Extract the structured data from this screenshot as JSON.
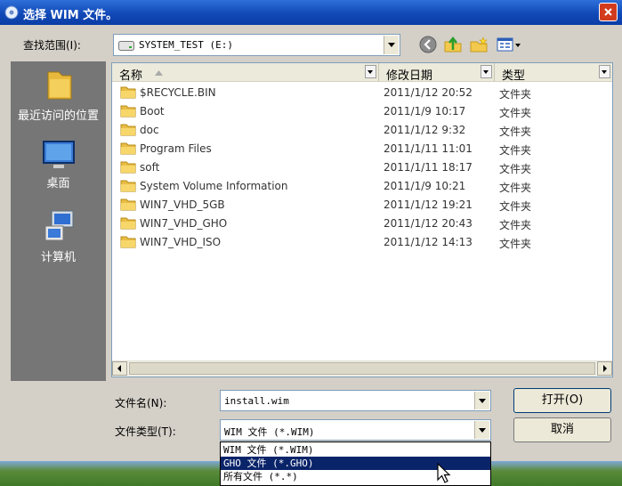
{
  "window": {
    "title": "选择 WIM 文件。"
  },
  "lookin": {
    "label": "查找范围(I):",
    "value": "SYSTEM_TEST  (E:)"
  },
  "places": [
    {
      "label": "最近访问的位置",
      "icon": "recent-folder-icon"
    },
    {
      "label": "桌面",
      "icon": "desktop-icon"
    },
    {
      "label": "计算机",
      "icon": "computer-icon"
    }
  ],
  "columns": {
    "name": "名称",
    "modified": "修改日期",
    "type": "类型"
  },
  "files": [
    {
      "name": "$RECYCLE.BIN",
      "date": "2011/1/12 20:52",
      "type": "文件夹"
    },
    {
      "name": "Boot",
      "date": "2011/1/9 10:17",
      "type": "文件夹"
    },
    {
      "name": "doc",
      "date": "2011/1/12 9:32",
      "type": "文件夹"
    },
    {
      "name": "Program Files",
      "date": "2011/1/11 11:01",
      "type": "文件夹"
    },
    {
      "name": "soft",
      "date": "2011/1/11 18:17",
      "type": "文件夹"
    },
    {
      "name": "System Volume Information",
      "date": "2011/1/9 10:21",
      "type": "文件夹"
    },
    {
      "name": "WIN7_VHD_5GB",
      "date": "2011/1/12 19:21",
      "type": "文件夹"
    },
    {
      "name": "WIN7_VHD_GHO",
      "date": "2011/1/12 20:43",
      "type": "文件夹"
    },
    {
      "name": "WIN7_VHD_ISO",
      "date": "2011/1/12 14:13",
      "type": "文件夹"
    }
  ],
  "filename": {
    "label": "文件名(N):",
    "value": "install.wim"
  },
  "filetype": {
    "label": "文件类型(T):",
    "value": "WIM 文件 (*.WIM)",
    "options": [
      "WIM 文件 (*.WIM)",
      "GHO 文件 (*.GHO)",
      "所有文件 (*.*)"
    ],
    "highlighted_index": 1
  },
  "buttons": {
    "open": "打开(O)",
    "cancel": "取消"
  },
  "colors": {
    "titlebar": "#1149b8",
    "highlight": "#0a246a",
    "places_bg": "#767676"
  }
}
